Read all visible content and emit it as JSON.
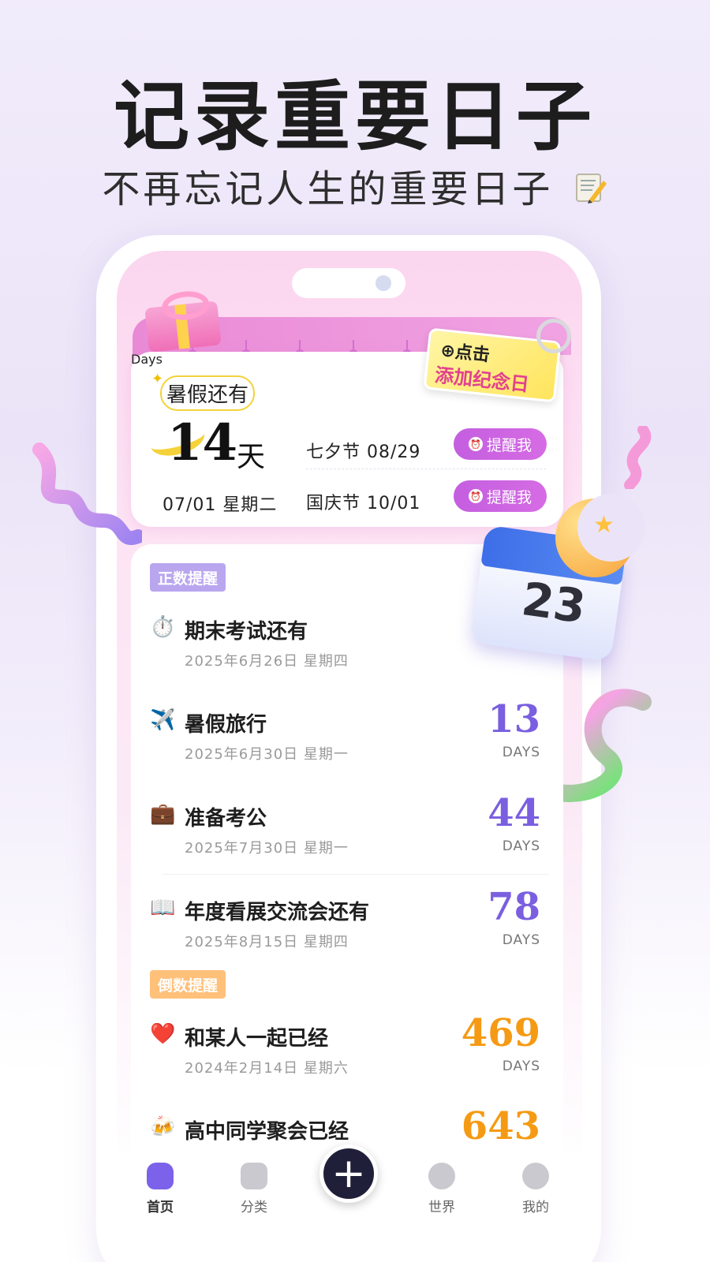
{
  "headline": "记录重要日子",
  "subheadline": "不再忘记人生的重要日子",
  "memo_icon": "memo-pencil-icon",
  "card": {
    "summer_label": "暑假还有",
    "days": "14",
    "unit": "天",
    "today_date": "07/01 星期二",
    "add_sticker_line1": "⊕点击",
    "add_sticker_line2": "添加纪念日",
    "watermark": "Days",
    "holidays": [
      {
        "label": "七夕节 08/29",
        "button": "提醒我"
      },
      {
        "label": "国庆节 10/01",
        "button": "提醒我"
      }
    ]
  },
  "sections": {
    "count_up_tag": "正数提醒",
    "count_down_tag": "倒数提醒"
  },
  "events_up": [
    {
      "icon": "⏱️",
      "title": "期末考试还有",
      "date": "2025年6月26日  星期四",
      "days": "",
      "unit": ""
    },
    {
      "icon": "✈️",
      "title": "暑假旅行",
      "date": "2025年6月30日  星期一",
      "days": "13",
      "unit": "DAYS"
    },
    {
      "icon": "💼",
      "title": "准备考公",
      "date": "2025年7月30日  星期一",
      "days": "44",
      "unit": "DAYS"
    },
    {
      "icon": "📖",
      "title": "年度看展交流会还有",
      "date": "2025年8月15日  星期四",
      "days": "78",
      "unit": "DAYS"
    }
  ],
  "events_down": [
    {
      "icon": "❤️",
      "title": "和某人一起已经",
      "date": "2024年2月14日  星期六",
      "days": "469",
      "unit": "DAYS"
    },
    {
      "icon": "🍻",
      "title": "高中同学聚会已经",
      "date": "",
      "days": "643",
      "unit": ""
    }
  ],
  "calendar_decoration": "23",
  "tabbar": {
    "home": "首页",
    "category": "分类",
    "add": "+",
    "world": "世界",
    "mine": "我的"
  },
  "colors": {
    "accent_purple": "#7a5fe0",
    "accent_orange": "#f59a14",
    "remind_button": "#c45ee0",
    "tab_active": "#7c62ea"
  }
}
